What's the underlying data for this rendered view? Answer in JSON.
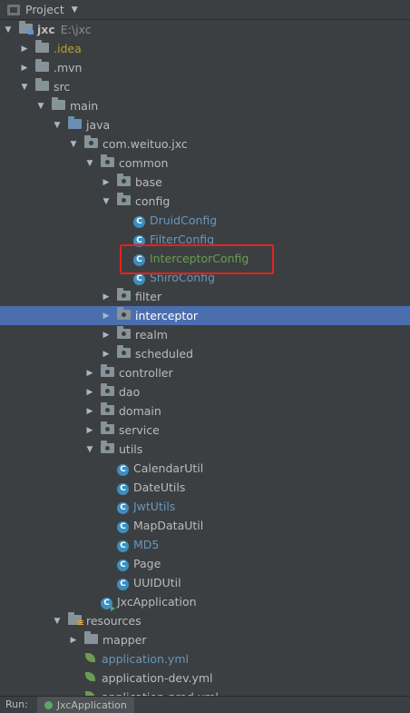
{
  "header": {
    "title": "Project"
  },
  "tree": [
    {
      "label": "jxc",
      "suffix": "E:\\jxc",
      "arrow": "open",
      "icon": "folder-module",
      "color": "default",
      "indent": 0
    },
    {
      "label": ".idea",
      "arrow": "closed",
      "icon": "folder",
      "color": "yellow",
      "indent": 1
    },
    {
      "label": ".mvn",
      "arrow": "closed",
      "icon": "folder",
      "color": "default",
      "indent": 1
    },
    {
      "label": "src",
      "arrow": "open",
      "icon": "folder",
      "color": "default",
      "indent": 1
    },
    {
      "label": "main",
      "arrow": "open",
      "icon": "folder",
      "color": "default",
      "indent": 2
    },
    {
      "label": "java",
      "arrow": "open",
      "icon": "folder-source",
      "color": "default",
      "indent": 3
    },
    {
      "label": "com.weituo.jxc",
      "arrow": "open",
      "icon": "folder-package",
      "color": "default",
      "indent": 4
    },
    {
      "label": "common",
      "arrow": "open",
      "icon": "folder-package",
      "color": "default",
      "indent": 5
    },
    {
      "label": "base",
      "arrow": "closed",
      "icon": "folder-package",
      "color": "default",
      "indent": 6
    },
    {
      "label": "config",
      "arrow": "open",
      "icon": "folder-package",
      "color": "default",
      "indent": 6
    },
    {
      "label": "DruidConfig",
      "arrow": "none",
      "icon": "class",
      "color": "blue",
      "indent": 7
    },
    {
      "label": "FilterConfig",
      "arrow": "none",
      "icon": "class",
      "color": "blue",
      "indent": 7
    },
    {
      "label": "InterceptorConfig",
      "arrow": "none",
      "icon": "class",
      "color": "green",
      "indent": 7
    },
    {
      "label": "ShiroConfig",
      "arrow": "none",
      "icon": "class",
      "color": "blue",
      "indent": 7
    },
    {
      "label": "filter",
      "arrow": "closed",
      "icon": "folder-package",
      "color": "default",
      "indent": 6
    },
    {
      "label": "interceptor",
      "arrow": "closed",
      "icon": "folder-package",
      "color": "selected",
      "indent": 6,
      "selected": true
    },
    {
      "label": "realm",
      "arrow": "closed",
      "icon": "folder-package",
      "color": "default",
      "indent": 6
    },
    {
      "label": "scheduled",
      "arrow": "closed",
      "icon": "folder-package",
      "color": "default",
      "indent": 6
    },
    {
      "label": "controller",
      "arrow": "closed",
      "icon": "folder-package",
      "color": "default",
      "indent": 5
    },
    {
      "label": "dao",
      "arrow": "closed",
      "icon": "folder-package",
      "color": "default",
      "indent": 5
    },
    {
      "label": "domain",
      "arrow": "closed",
      "icon": "folder-package",
      "color": "default",
      "indent": 5
    },
    {
      "label": "service",
      "arrow": "closed",
      "icon": "folder-package",
      "color": "default",
      "indent": 5
    },
    {
      "label": "utils",
      "arrow": "open",
      "icon": "folder-package",
      "color": "default",
      "indent": 5
    },
    {
      "label": "CalendarUtil",
      "arrow": "none",
      "icon": "class",
      "color": "default",
      "indent": 6
    },
    {
      "label": "DateUtils",
      "arrow": "none",
      "icon": "class",
      "color": "default",
      "indent": 6
    },
    {
      "label": "JwtUtils",
      "arrow": "none",
      "icon": "class",
      "color": "blue",
      "indent": 6
    },
    {
      "label": "MapDataUtil",
      "arrow": "none",
      "icon": "class",
      "color": "default",
      "indent": 6
    },
    {
      "label": "MD5",
      "arrow": "none",
      "icon": "class",
      "color": "blue",
      "indent": 6
    },
    {
      "label": "Page",
      "arrow": "none",
      "icon": "class",
      "color": "default",
      "indent": 6
    },
    {
      "label": "UUIDUtil",
      "arrow": "none",
      "icon": "class",
      "color": "default",
      "indent": 6
    },
    {
      "label": "JxcApplication",
      "arrow": "none",
      "icon": "class-run",
      "color": "default",
      "indent": 5
    },
    {
      "label": "resources",
      "arrow": "open",
      "icon": "folder-resources",
      "color": "default",
      "indent": 3
    },
    {
      "label": "mapper",
      "arrow": "closed",
      "icon": "folder",
      "color": "default",
      "indent": 4
    },
    {
      "label": "application.yml",
      "arrow": "none",
      "icon": "yml",
      "color": "blue",
      "indent": 4
    },
    {
      "label": "application-dev.yml",
      "arrow": "none",
      "icon": "yml",
      "color": "default",
      "indent": 4
    },
    {
      "label": "application-prod.yml",
      "arrow": "none",
      "icon": "yml",
      "color": "default",
      "indent": 4
    }
  ],
  "bottom": {
    "run_label": "Run:",
    "tab_label": "JxcApplication"
  },
  "colors": {
    "background": "#3c3f41",
    "selection": "#4b6eaf",
    "highlight": "#e62020"
  }
}
